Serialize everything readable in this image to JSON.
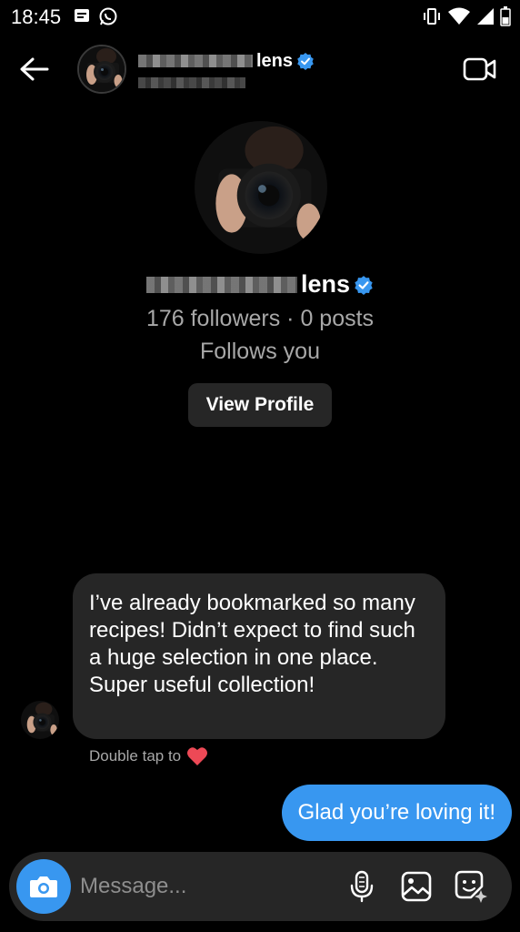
{
  "status_bar": {
    "time": "18:45",
    "left_icons": [
      "message-notification-icon",
      "whatsapp-icon"
    ],
    "right_icons": [
      "vibrate-icon",
      "wifi-icon",
      "signal-icon",
      "battery-icon"
    ]
  },
  "header": {
    "username_suffix": "lens",
    "verified": true,
    "icons": [
      "back-arrow-icon",
      "video-call-icon"
    ]
  },
  "profile": {
    "username_suffix": "lens",
    "stats": "176 followers · 0 posts",
    "follows_status": "Follows you",
    "view_profile_label": "View Profile"
  },
  "messages": {
    "incoming_text": "I’ve already bookmarked so many recipes! Didn’t expect to find such a huge selection in one place. Super useful collection!",
    "reaction_hint": "Double tap to",
    "reaction_icon": "heart-icon",
    "outgoing_text": "Glad you’re loving it!"
  },
  "composer": {
    "placeholder": "Message...",
    "icons": [
      "camera-icon",
      "microphone-icon",
      "gallery-icon",
      "sticker-icon"
    ]
  },
  "colors": {
    "background": "#000000",
    "bubble_incoming": "#262626",
    "bubble_outgoing": "#3897f0",
    "verified_blue": "#3897f0",
    "muted_text": "#a8a8a8",
    "heart_red": "#ed4956"
  }
}
